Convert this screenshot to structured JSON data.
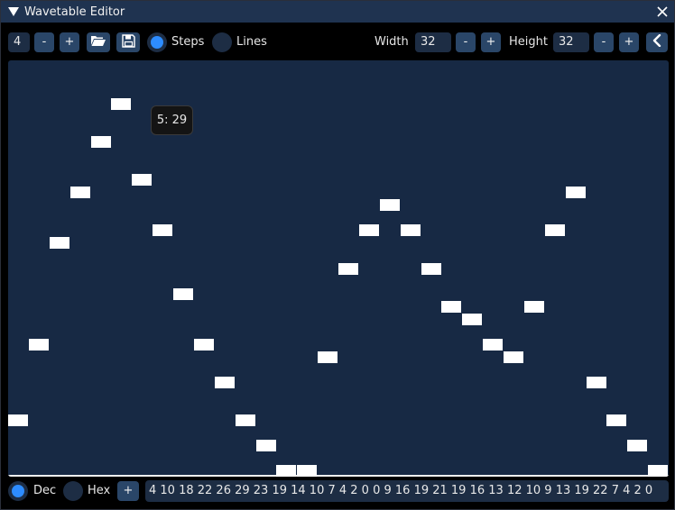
{
  "window": {
    "title": "Wavetable Editor"
  },
  "toolbar": {
    "step_value": "4",
    "minus_label": "-",
    "plus_label": "+",
    "open_icon": "folder-open-icon",
    "save_icon": "floppy-save-icon",
    "mode_steps_label": "Steps",
    "mode_lines_label": "Lines",
    "mode_selected": "Steps",
    "width_label": "Width",
    "width_value": "32",
    "height_label": "Height",
    "height_value": "32",
    "collapse_icon": "chevron-left-icon"
  },
  "editor": {
    "tooltip": "5: 29",
    "max_value": 32,
    "values": [
      4,
      10,
      18,
      22,
      26,
      29,
      23,
      19,
      14,
      10,
      7,
      4,
      2,
      0,
      0,
      9,
      16,
      19,
      21,
      19,
      16,
      13,
      12,
      10,
      9,
      13,
      19,
      22,
      7,
      4,
      2,
      0
    ]
  },
  "bottom": {
    "dec_label": "Dec",
    "hex_label": "Hex",
    "format_selected": "Dec",
    "add_label": "+",
    "values_text": "4 10 18 22 26 29 23 19 14 10 7 4 2 0 0 9 16 19 21 19 16 13 12 10 9 13 19 22 7 4 2 0"
  },
  "colors": {
    "titlebar": "#1f3350",
    "canvas": "#172944",
    "field": "#1d2d44",
    "button": "#2a4668",
    "accent": "#2d8cff",
    "step": "#ffffff"
  }
}
